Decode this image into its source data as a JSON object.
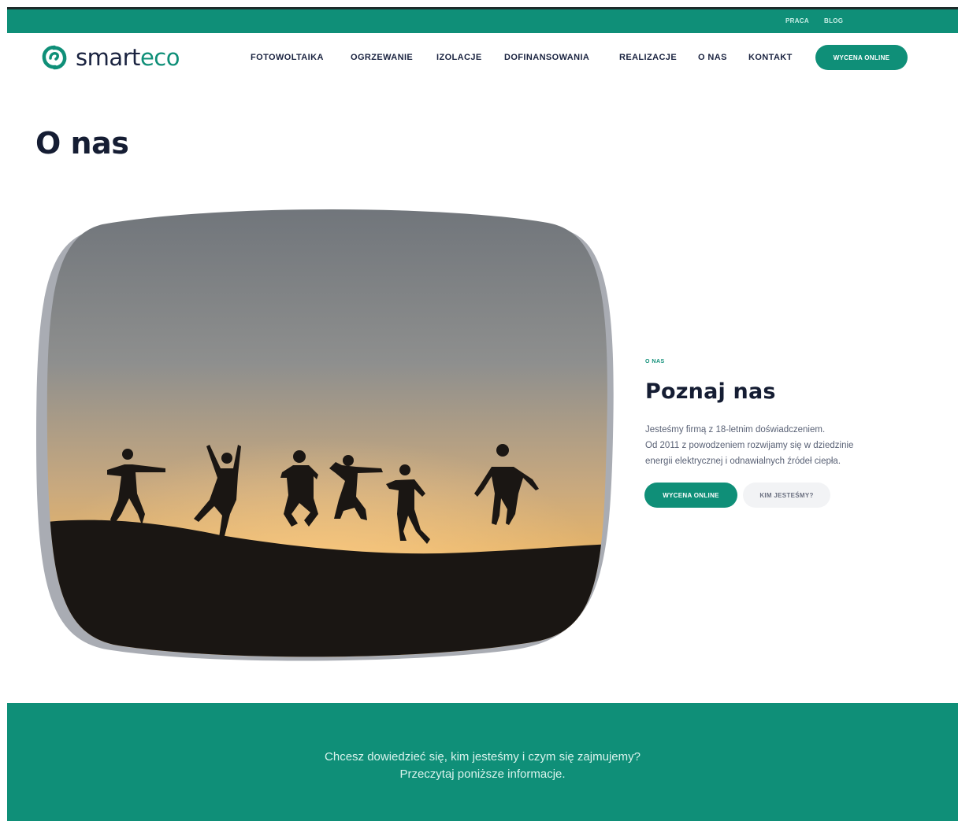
{
  "topbar": {
    "links": [
      {
        "label": "PRACA"
      },
      {
        "label": "BLOG"
      }
    ]
  },
  "logo": {
    "text_part1": "smart",
    "text_part2": "eco",
    "icon": "smarteco-swirl-icon"
  },
  "nav": {
    "items": [
      {
        "label": "FOTOWOLTAIKA"
      },
      {
        "label": "OGRZEWANIE"
      },
      {
        "label": "IZOLACJE"
      },
      {
        "label": "DOFINANSOWANIA"
      },
      {
        "label": "REALIZACJE"
      },
      {
        "label": "O NAS"
      },
      {
        "label": "KONTAKT"
      }
    ],
    "cta_label": "WYCENA ONLINE"
  },
  "page": {
    "title": "O nas"
  },
  "about": {
    "eyebrow": "O NAS",
    "title": "Poznaj nas",
    "lead_line1": "Jesteśmy firmą z 18-letnim doświadczeniem.",
    "lead_line2": "Od 2011 z powodzeniem rozwijamy się w dziedzinie",
    "lead_line3": "energii elektrycznej i odnawialnych źródeł ciepła.",
    "primary_button": "WYCENA ONLINE",
    "secondary_button": "KIM JESTEŚMY?"
  },
  "banner": {
    "line1": "Chcesz dowiedzieć się, kim jesteśmy i czym się zajmujemy?",
    "line2": "Przeczytaj poniższe informacje."
  },
  "colors": {
    "brand": "#0f8f78",
    "heading": "#151d33",
    "body_text": "#5a6276"
  }
}
